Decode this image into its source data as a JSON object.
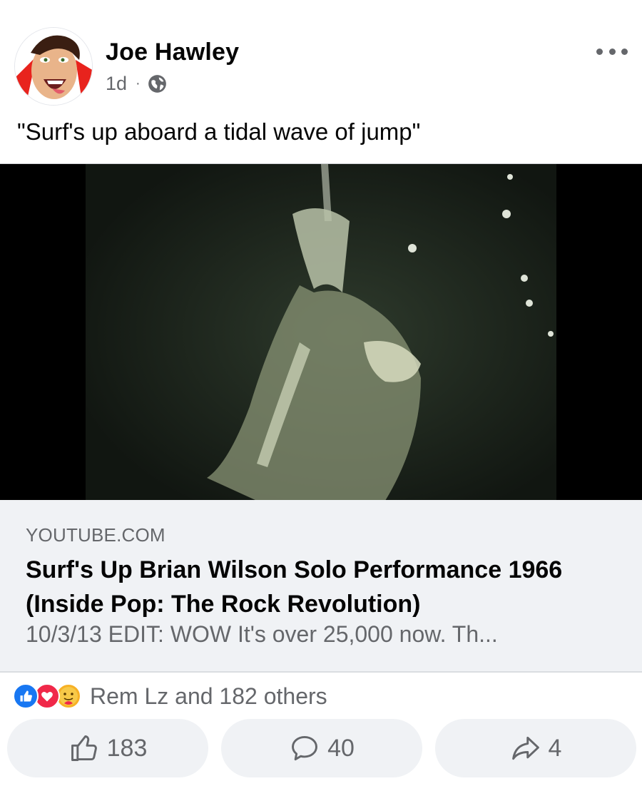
{
  "post": {
    "author": "Joe Hawley",
    "time": "1d",
    "separator": "·",
    "privacy_icon": "globe-icon",
    "caption": "\"Surf's up aboard a tidal wave of jump\""
  },
  "link_preview": {
    "domain": "YOUTUBE.COM",
    "title": "Surf's Up Brian Wilson Solo Performance 1966 (Inside Pop: The Rock Revolution)",
    "description": "10/3/13 EDIT: WOW It's over 25,000 now. Th..."
  },
  "reactions": {
    "icons": [
      "like-icon",
      "love-icon",
      "care-icon"
    ],
    "summary": "Rem Lz and 182 others"
  },
  "actions": {
    "like_count": "183",
    "comment_count": "40",
    "share_count": "4"
  },
  "colors": {
    "like": "#1877f2",
    "love": "#f02849",
    "care": "#f7b125",
    "secondary_text": "#65676b",
    "card_bg": "#f0f2f5"
  }
}
